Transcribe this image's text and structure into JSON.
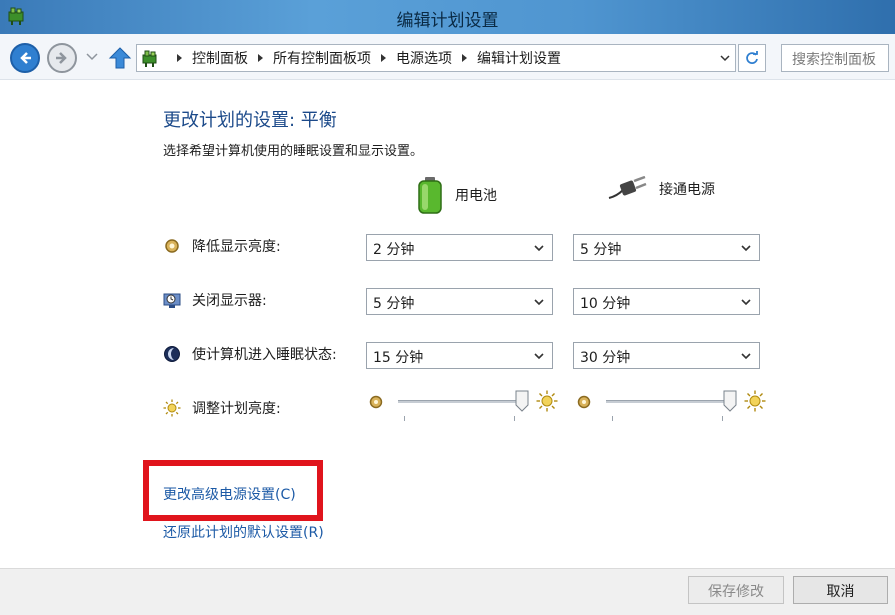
{
  "window": {
    "title": "编辑计划设置",
    "app_icon": "power-options-icon"
  },
  "nav": {
    "breadcrumbs": [
      "控制面板",
      "所有控制面板项",
      "电源选项",
      "编辑计划设置"
    ],
    "search_placeholder": "搜索控制面板"
  },
  "content": {
    "heading": "更改计划的设置: 平衡",
    "subheading": "选择希望计算机使用的睡眠设置和显示设置。",
    "columns": {
      "battery": "用电池",
      "ac": "接通电源"
    },
    "rows": [
      {
        "label": "降低显示亮度:",
        "icon": "dim-display-icon",
        "battery": "2 分钟",
        "ac": "5 分钟"
      },
      {
        "label": "关闭显示器:",
        "icon": "monitor-clock-icon",
        "battery": "5 分钟",
        "ac": "10 分钟"
      },
      {
        "label": "使计算机进入睡眠状态:",
        "icon": "moon-sleep-icon",
        "battery": "15 分钟",
        "ac": "30 分钟"
      }
    ],
    "brightness": {
      "label": "调整计划亮度:",
      "battery_level": 1.0,
      "ac_level": 1.0
    },
    "links": {
      "advanced": "更改高级电源设置(C)",
      "restore": "还原此计划的默认设置(R)"
    }
  },
  "footer": {
    "save": "保存修改",
    "cancel": "取消"
  },
  "colors": {
    "accent_link": "#1c5aa6",
    "heading": "#1c4a8a",
    "highlight": "#e0141c"
  }
}
